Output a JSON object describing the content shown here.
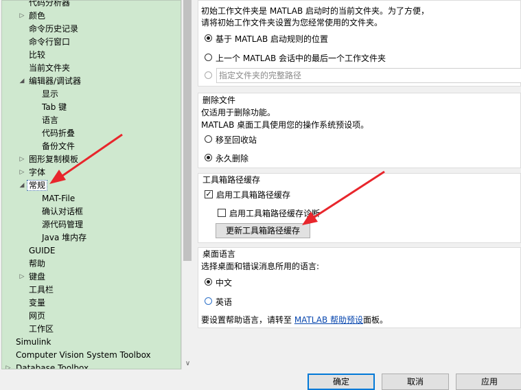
{
  "tree": {
    "items": [
      {
        "label": "代码分析器",
        "indent": 2,
        "arrow": ""
      },
      {
        "label": "颜色",
        "indent": 2,
        "arrow": "▷"
      },
      {
        "label": "命令历史记录",
        "indent": 2,
        "arrow": ""
      },
      {
        "label": "命令行窗口",
        "indent": 2,
        "arrow": ""
      },
      {
        "label": "比较",
        "indent": 2,
        "arrow": ""
      },
      {
        "label": "当前文件夹",
        "indent": 2,
        "arrow": ""
      },
      {
        "label": "编辑器/调试器",
        "indent": 2,
        "arrow": "◢"
      },
      {
        "label": "显示",
        "indent": 3,
        "arrow": ""
      },
      {
        "label": "Tab 键",
        "indent": 3,
        "arrow": ""
      },
      {
        "label": "语言",
        "indent": 3,
        "arrow": ""
      },
      {
        "label": "代码折叠",
        "indent": 3,
        "arrow": ""
      },
      {
        "label": "备份文件",
        "indent": 3,
        "arrow": ""
      },
      {
        "label": "图形复制模板",
        "indent": 2,
        "arrow": "▷"
      },
      {
        "label": "字体",
        "indent": 2,
        "arrow": "▷"
      },
      {
        "label": "常规",
        "indent": 2,
        "arrow": "◢",
        "selected": true
      },
      {
        "label": "MAT-File",
        "indent": 3,
        "arrow": ""
      },
      {
        "label": "确认对话框",
        "indent": 3,
        "arrow": ""
      },
      {
        "label": "源代码管理",
        "indent": 3,
        "arrow": ""
      },
      {
        "label": "Java 堆内存",
        "indent": 3,
        "arrow": ""
      },
      {
        "label": "GUIDE",
        "indent": 2,
        "arrow": ""
      },
      {
        "label": "帮助",
        "indent": 2,
        "arrow": ""
      },
      {
        "label": "键盘",
        "indent": 2,
        "arrow": "▷"
      },
      {
        "label": "工具栏",
        "indent": 2,
        "arrow": ""
      },
      {
        "label": "变量",
        "indent": 2,
        "arrow": ""
      },
      {
        "label": "网页",
        "indent": 2,
        "arrow": ""
      },
      {
        "label": "工作区",
        "indent": 2,
        "arrow": ""
      },
      {
        "label": "Simulink",
        "indent": 1,
        "arrow": ""
      },
      {
        "label": "Computer Vision System Toolbox",
        "indent": 1,
        "arrow": ""
      },
      {
        "label": "Database Toolbox",
        "indent": 1,
        "arrow": "▷"
      }
    ]
  },
  "startup": {
    "desc1": "初始工作文件夹是 MATLAB 启动时的当前文件夹。为了方便，",
    "desc2": "请将初始工作文件夹设置为您经常使用的文件夹。",
    "opt1": "基于 MATLAB 启动规则的位置",
    "opt2": "上一个 MATLAB 会话中的最后一个工作文件夹",
    "path_placeholder": "指定文件夹的完整路径"
  },
  "delete": {
    "title": "删除文件",
    "desc1": "仅适用于删除功能。",
    "desc2": "MATLAB 桌面工具使用您的操作系统预设项。",
    "opt1": "移至回收站",
    "opt2": "永久删除"
  },
  "toolbox": {
    "title": "工具箱路径缓存",
    "check1": "启用工具箱路径缓存",
    "check2": "启用工具箱路径缓存诊断",
    "button": "更新工具箱路径缓存"
  },
  "language": {
    "title": "桌面语言",
    "desc": "选择桌面和错误消息所用的语言:",
    "opt1": "中文",
    "opt2": "英语",
    "help_prefix": "要设置帮助语言，请转至 ",
    "help_link": "MATLAB 帮助预设",
    "help_suffix": "面板。"
  },
  "footer": {
    "ok": "确定",
    "cancel": "取消",
    "apply": "应用"
  },
  "colors": {
    "tree_bg": "#cfe8cf",
    "annotation": "#e8262c"
  }
}
